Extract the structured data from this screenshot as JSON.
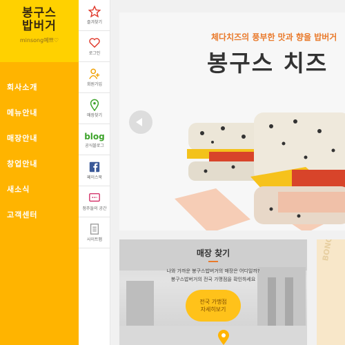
{
  "brand": {
    "logo": "봉구스 밥버거",
    "sub": "minsong예쁘♡"
  },
  "menu": [
    "회사소개",
    "메뉴안내",
    "매장안내",
    "창업안내",
    "새소식",
    "고객센터"
  ],
  "quick": {
    "bookmark": "즐겨찾기",
    "login": "로그인",
    "join": "회원가입",
    "store": "매장찾기",
    "blog_logo": "blog",
    "blog": "공식블로그",
    "facebook": "페이스북",
    "diff": "점주들의 공간",
    "sitemap": "사이트맵"
  },
  "banner": {
    "sub": "체다치즈의 풍부한 맛과 향을 밥버거",
    "title": "봉구스 치즈"
  },
  "card": {
    "title": "매장 찾기",
    "desc1": "나와 가까운 봉구스밥버거의 매장은 어디일까?",
    "desc2": "봉구스밥버거의 전국 가맹점을 확인하세요",
    "badge1": "전국 가맹점",
    "badge2": "자세히보기"
  },
  "card2": {
    "text": "BONG"
  },
  "colors": {
    "sidebar": "#ffb400",
    "logo_bg": "#ffd100",
    "accent": "#e9792a",
    "blog_green": "#3ca32a"
  }
}
